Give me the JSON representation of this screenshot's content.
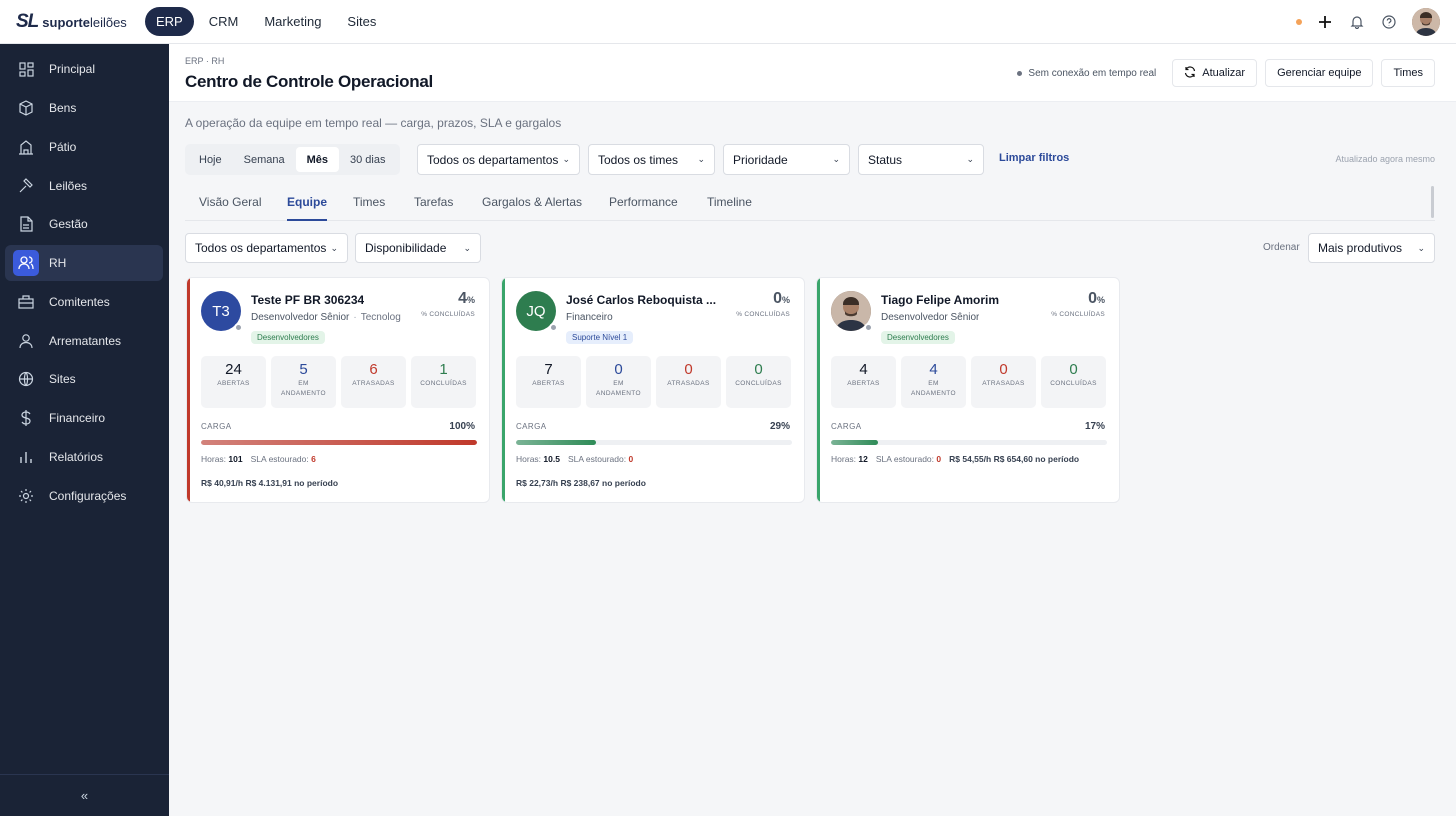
{
  "brand": {
    "mark": "SL",
    "name_bold": "suporte",
    "name_light": "leilões"
  },
  "topnav": [
    {
      "label": "ERP",
      "active": true
    },
    {
      "label": "CRM",
      "active": false
    },
    {
      "label": "Marketing",
      "active": false
    },
    {
      "label": "Sites",
      "active": false
    }
  ],
  "topbar_icons": [
    "status-dot",
    "plus-icon",
    "bell-icon",
    "help-icon",
    "user-avatar"
  ],
  "sidebar": {
    "items": [
      {
        "label": "Principal",
        "icon": "grid-icon",
        "active": false
      },
      {
        "label": "Bens",
        "icon": "box-icon",
        "active": false
      },
      {
        "label": "Pátio",
        "icon": "building-icon",
        "active": false
      },
      {
        "label": "Leilões",
        "icon": "gavel-icon",
        "active": false
      },
      {
        "label": "Gestão",
        "icon": "document-icon",
        "active": false
      },
      {
        "label": "RH",
        "icon": "users-icon",
        "active": true
      },
      {
        "label": "Comitentes",
        "icon": "briefcase-icon",
        "active": false
      },
      {
        "label": "Arrematantes",
        "icon": "user-icon",
        "active": false
      },
      {
        "label": "Sites",
        "icon": "globe-icon",
        "active": false
      },
      {
        "label": "Financeiro",
        "icon": "dollar-icon",
        "active": false
      },
      {
        "label": "Relatórios",
        "icon": "bar-chart-icon",
        "active": false
      },
      {
        "label": "Configurações",
        "icon": "gear-icon",
        "active": false
      }
    ],
    "collapse": "«"
  },
  "header": {
    "breadcrumb": "ERP · RH",
    "title": "Centro de Controle Operacional",
    "connection": "Sem conexão em tempo real",
    "refresh_label": "Atualizar",
    "manage_label": "Gerenciar equipe",
    "teams_label": "Times"
  },
  "subtitle": "A operação da equipe em tempo real — carga, prazos, SLA e gargalos",
  "periods": [
    {
      "label": "Hoje",
      "active": false
    },
    {
      "label": "Semana",
      "active": false
    },
    {
      "label": "Mês",
      "active": true
    },
    {
      "label": "30 dias",
      "active": false
    }
  ],
  "filters": {
    "department": "Todos os departamentos",
    "team": "Todos os times",
    "priority": "Prioridade",
    "status": "Status",
    "clear": "Limpar filtros",
    "updated": "Atualizado agora mesmo"
  },
  "tabs": [
    {
      "label": "Visão Geral",
      "active": false
    },
    {
      "label": "Equipe",
      "active": true
    },
    {
      "label": "Times",
      "active": false
    },
    {
      "label": "Tarefas",
      "active": false
    },
    {
      "label": "Gargalos & Alertas",
      "active": false
    },
    {
      "label": "Performance",
      "active": false
    },
    {
      "label": "Timeline",
      "active": false
    }
  ],
  "team_filters": {
    "department": "Todos os departamentos",
    "availability": "Disponibilidade",
    "order_label": "Ordenar",
    "order_value": "Mais produtivos"
  },
  "stat_labels": {
    "open": "ABERTAS",
    "progress_1": "EM",
    "progress_2": "ANDAMENTO",
    "late": "ATRASADAS",
    "done": "CONCLUÍDAS",
    "pct_label": "% CONCLUÍDAS",
    "load": "CARGA",
    "hours": "Horas:",
    "sla": "SLA estourado:"
  },
  "members": [
    {
      "initials": "T3",
      "avatar_color": "#2d4aa0",
      "photo": false,
      "name": "Teste PF BR 306234",
      "role": "Desenvolvedor Sênior",
      "dept": "Tecnolog",
      "tag": "Desenvolvedores",
      "tag_kind": "green",
      "pct": "4",
      "pct_unit": "%",
      "open": "24",
      "in_progress": "5",
      "late": "6",
      "done": "1",
      "load_pct": 100,
      "load_label": "100%",
      "load_color": "#c0392b",
      "accent": "#c0392b",
      "hours": "101",
      "sla_over": "6",
      "rate": "R$ 40,91/h",
      "period_total": "R$ 4.131,91 no período"
    },
    {
      "initials": "JQ",
      "avatar_color": "#2e7d4f",
      "photo": false,
      "name": "José Carlos Reboquista ...",
      "role": "Financeiro",
      "dept": "",
      "tag": "Suporte Nível 1",
      "tag_kind": "blue",
      "pct": "0",
      "pct_unit": "%",
      "open": "7",
      "in_progress": "0",
      "late": "0",
      "done": "0",
      "load_pct": 29,
      "load_label": "29%",
      "load_color": "#2e8b57",
      "accent": "#3aa56b",
      "hours": "10.5",
      "sla_over": "0",
      "rate": "R$ 22,73/h",
      "period_total": "R$ 238,67 no período"
    },
    {
      "initials": "",
      "avatar_color": "#7a6352",
      "photo": true,
      "name": "Tiago Felipe Amorim",
      "role": "Desenvolvedor Sênior",
      "dept": "",
      "tag": "Desenvolvedores",
      "tag_kind": "green",
      "pct": "0",
      "pct_unit": "%",
      "open": "4",
      "in_progress": "4",
      "late": "0",
      "done": "0",
      "load_pct": 17,
      "load_label": "17%",
      "load_color": "#2e8b57",
      "accent": "#3aa56b",
      "hours": "12",
      "sla_over": "0",
      "rate": "R$ 54,55/h",
      "period_total": "R$ 654,60 no período"
    }
  ]
}
